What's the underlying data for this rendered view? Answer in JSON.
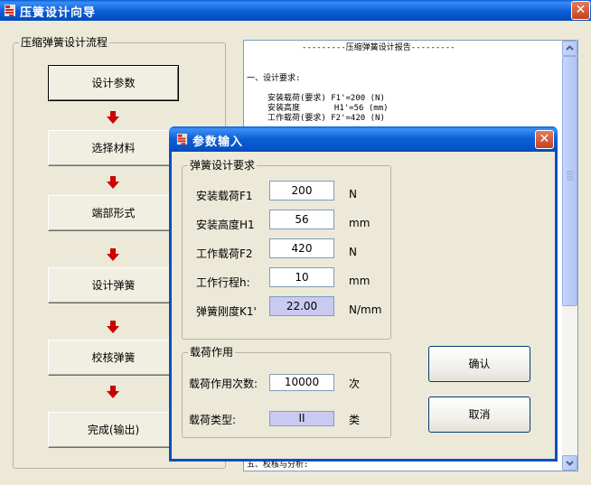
{
  "window": {
    "title": "压簧设计向导"
  },
  "flow": {
    "legend": "压缩弹簧设计流程",
    "steps": [
      "设计参数",
      "选择材料",
      "端部形式",
      "设计弹簧",
      "校核弹簧",
      "完成(输出)"
    ]
  },
  "report": {
    "header": "---------压缩弹簧设计报告---------",
    "section1": "一、设计要求:",
    "lines": [
      "安装载荷(要求) F1'=200 (N)",
      "安装高度       H1'=56 (mm)",
      "工作载荷(要求) F2'=420 (N)"
    ],
    "footer": "五、校核与分析:"
  },
  "dialog": {
    "title": "参数输入",
    "spring_group": {
      "legend": "弹簧设计要求",
      "fields": [
        {
          "label": "安装载荷F1",
          "value": "200",
          "unit": "N"
        },
        {
          "label": "安装高度H1",
          "value": "56",
          "unit": "mm"
        },
        {
          "label": "工作载荷F2",
          "value": "420",
          "unit": "N"
        },
        {
          "label": "工作行程h:",
          "value": "10",
          "unit": "mm"
        },
        {
          "label": "弹簧刚度K1'",
          "value": "22.00",
          "unit": "N/mm"
        }
      ]
    },
    "load_group": {
      "legend": "载荷作用",
      "cycles": {
        "label": "载荷作用次数:",
        "value": "10000",
        "unit": "次"
      },
      "type": {
        "label": "载荷类型:",
        "value": "II",
        "unit": "类"
      }
    },
    "ok_label": "确认",
    "cancel_label": "取消"
  },
  "colors": {
    "titlebar": "#0A5FD6",
    "close": "#C2431F",
    "readonly_field": "#C9C9F2",
    "arrow": "#CC0000"
  }
}
